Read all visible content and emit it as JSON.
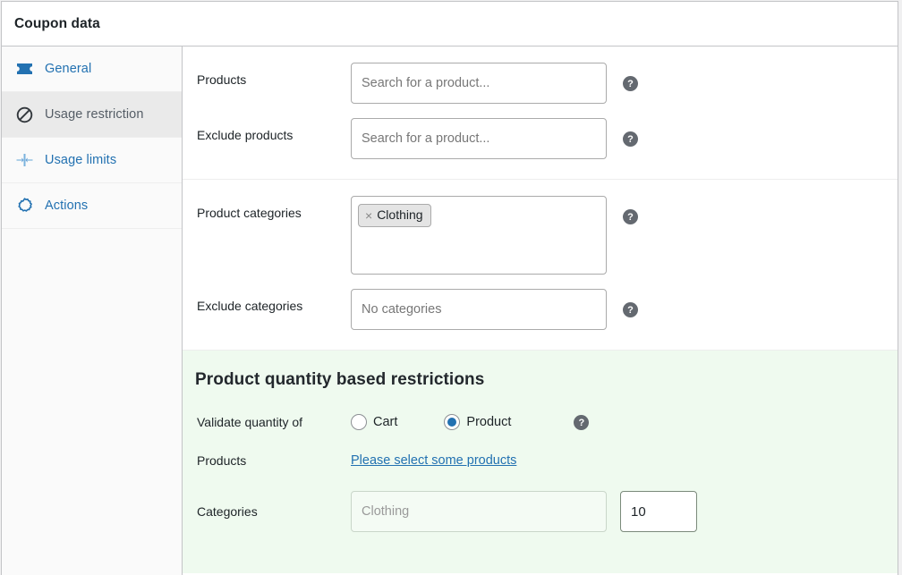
{
  "panel": {
    "title": "Coupon data"
  },
  "tabs": [
    {
      "label": "General",
      "icon": "ticket-icon",
      "active": false
    },
    {
      "label": "Usage restriction",
      "icon": "no-entry-icon",
      "active": true
    },
    {
      "label": "Usage limits",
      "icon": "usage-limits-icon",
      "active": false
    },
    {
      "label": "Actions",
      "icon": "gear-icon",
      "active": false
    }
  ],
  "fields": {
    "products": {
      "label": "Products",
      "placeholder": "Search for a product...",
      "value": ""
    },
    "exclude_products": {
      "label": "Exclude products",
      "placeholder": "Search for a product...",
      "value": ""
    },
    "product_categories": {
      "label": "Product categories",
      "tokens": [
        {
          "label": "Clothing",
          "remove": "×"
        }
      ]
    },
    "exclude_categories": {
      "label": "Exclude categories",
      "placeholder": "No categories",
      "value": ""
    }
  },
  "quantity_section": {
    "title": "Product quantity based restrictions",
    "validate_label": "Validate quantity of",
    "radios": [
      {
        "label": "Cart",
        "checked": false
      },
      {
        "label": "Product",
        "checked": true
      }
    ],
    "products_label": "Products",
    "products_link": "Please select some products",
    "categories_label": "Categories",
    "categories_placeholder": "Clothing",
    "categories_value": "",
    "quantity_value": "10"
  },
  "icons": {
    "help": "?"
  },
  "colors": {
    "link": "#2271b1",
    "active_tab_bg": "#eaeaea",
    "quantity_section_bg": "#effaef",
    "help_bubble": "#646970",
    "token_bg": "#e4e4e4"
  }
}
